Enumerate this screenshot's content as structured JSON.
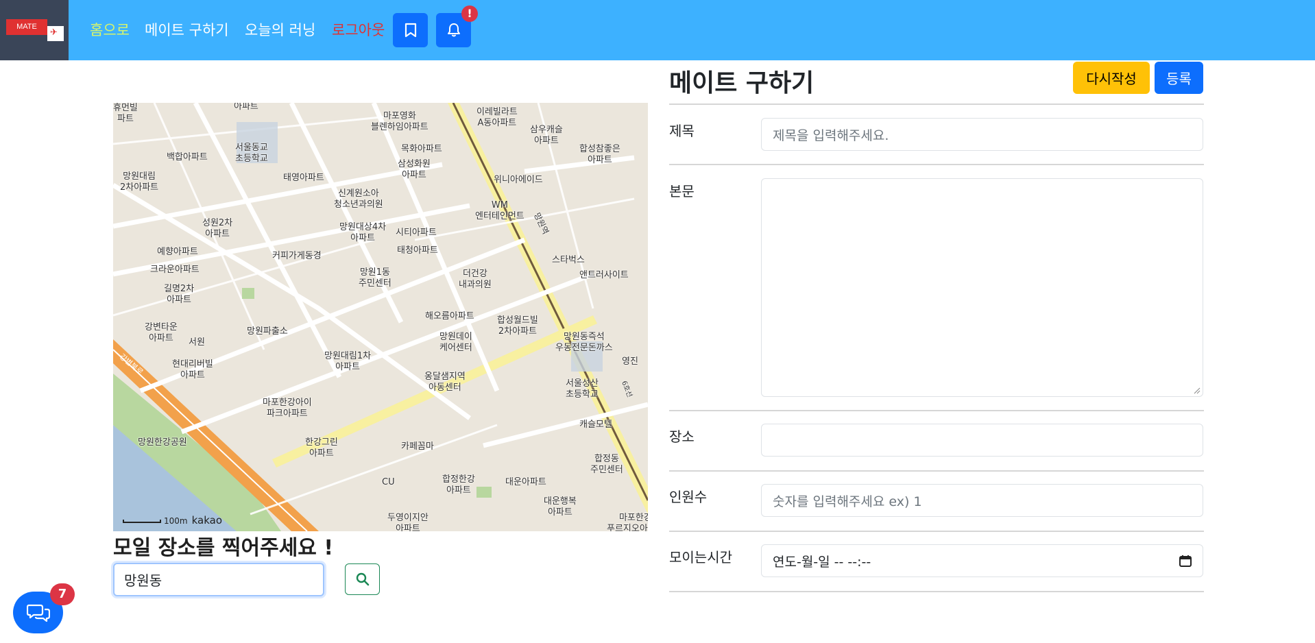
{
  "navbar": {
    "logo_text": "MATE",
    "links": {
      "home": "홈으로",
      "find_mate": "메이트 구하기",
      "today_running": "오늘의 러닝",
      "logout": "로그아웃"
    },
    "bookmark_icon": "bookmark-icon",
    "bell_icon": "bell-icon",
    "bell_badge": "!"
  },
  "map": {
    "labels": [
      "휴먼빌\n파트",
      "아파트",
      "마포영화\n블렌하임아파트",
      "이레빌라트\nA동아파트",
      "삼우캐슬\n아파트",
      "서울동교\n초등학교",
      "백합아파트",
      "목화아파트",
      "삼성화원\n아파트",
      "합성참좋은\n아파트",
      "망원대림\n2차아파트",
      "태영아파트",
      "위니아에이드",
      "신계원소아\n청소년과의원",
      "WM\n엔터테인먼트",
      "성원2차\n아파트",
      "망원대상4차\n아파트",
      "시티아파트",
      "태청아파트",
      "예향아파트",
      "커피가게동경",
      "스타벅스",
      "앤트러사이트",
      "망원1동\n주민센터",
      "더건강\n내과의원",
      "크라운아파트",
      "길명2차\n아파트",
      "해오름아파트",
      "합성월드빌\n2차아파트",
      "강변타운\n아파트",
      "서원",
      "망원파출소",
      "망원데이\n케어센터",
      "망원동즉석\n우동전문돈까스",
      "현대리버빌\n아파트",
      "망원대림1차\n아파트",
      "옹달샘지역\n아동센터",
      "서울성산\n초등학교",
      "영진",
      "마포한강아이\n파크아파트",
      "캐슬모텔",
      "망원한강공원",
      "한강그린\n아파트",
      "카페꼼마",
      "합정동\n주민센터",
      "CU",
      "합정한강\n아파트",
      "대운아파트",
      "대운행복\n아파트",
      "두영이지안\n아파트",
      "마포한강\n푸르지오아파트",
      "강변북로",
      "망원역",
      "6호선"
    ],
    "scale": "100m",
    "provider": "kakao"
  },
  "place_section": {
    "heading": "모일 장소를 찍어주세요 !",
    "search_value": "망원동",
    "search_icon": "search-icon"
  },
  "form": {
    "title": "메이트 구하기",
    "reset_label": "다시작성",
    "submit_label": "등록",
    "fields": {
      "title_label": "제목",
      "title_placeholder": "제목을 입력해주세요.",
      "body_label": "본문",
      "place_label": "장소",
      "people_label": "인원수",
      "people_placeholder": "숫자를 입력해주세요 ex) 1",
      "time_label": "모이는시간",
      "time_value": "연도-월-일 -- --:--"
    }
  },
  "chat": {
    "icon": "chat-bubbles-icon",
    "badge": "7"
  },
  "colors": {
    "navbar": "#3db1ff",
    "primary": "#0d6efd",
    "warning": "#ffc107",
    "danger": "#dc3545",
    "home_link": "#d8f56a"
  }
}
